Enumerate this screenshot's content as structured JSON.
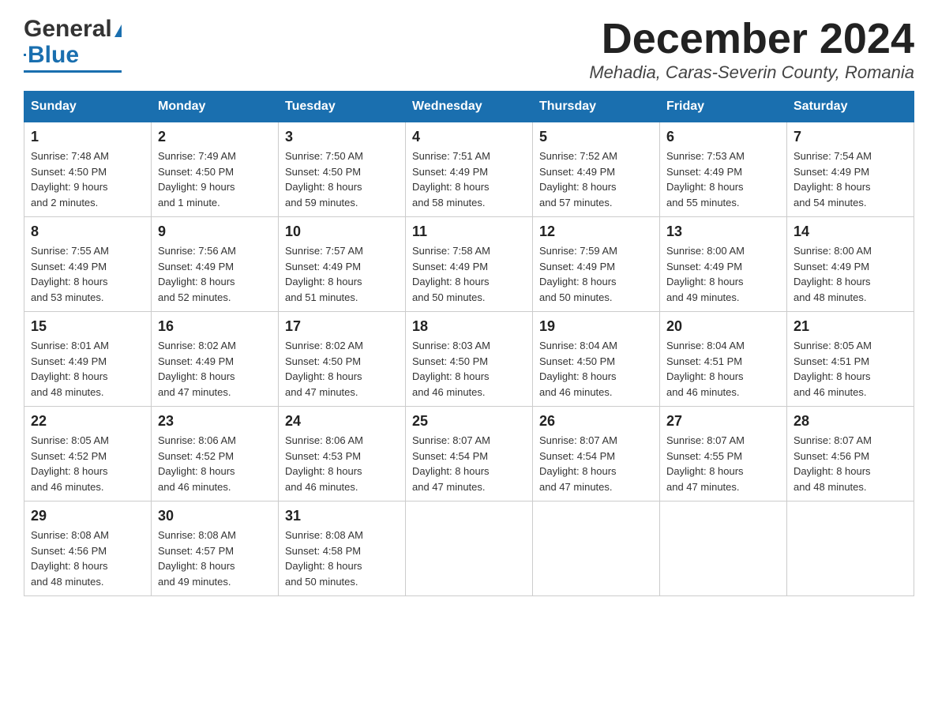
{
  "header": {
    "logo_general": "General",
    "logo_blue": "Blue",
    "month_title": "December 2024",
    "location": "Mehadia, Caras-Severin County, Romania"
  },
  "weekdays": [
    "Sunday",
    "Monday",
    "Tuesday",
    "Wednesday",
    "Thursday",
    "Friday",
    "Saturday"
  ],
  "weeks": [
    [
      {
        "day": "1",
        "sunrise": "7:48 AM",
        "sunset": "4:50 PM",
        "daylight": "9 hours and 2 minutes."
      },
      {
        "day": "2",
        "sunrise": "7:49 AM",
        "sunset": "4:50 PM",
        "daylight": "9 hours and 1 minute."
      },
      {
        "day": "3",
        "sunrise": "7:50 AM",
        "sunset": "4:50 PM",
        "daylight": "8 hours and 59 minutes."
      },
      {
        "day": "4",
        "sunrise": "7:51 AM",
        "sunset": "4:49 PM",
        "daylight": "8 hours and 58 minutes."
      },
      {
        "day": "5",
        "sunrise": "7:52 AM",
        "sunset": "4:49 PM",
        "daylight": "8 hours and 57 minutes."
      },
      {
        "day": "6",
        "sunrise": "7:53 AM",
        "sunset": "4:49 PM",
        "daylight": "8 hours and 55 minutes."
      },
      {
        "day": "7",
        "sunrise": "7:54 AM",
        "sunset": "4:49 PM",
        "daylight": "8 hours and 54 minutes."
      }
    ],
    [
      {
        "day": "8",
        "sunrise": "7:55 AM",
        "sunset": "4:49 PM",
        "daylight": "8 hours and 53 minutes."
      },
      {
        "day": "9",
        "sunrise": "7:56 AM",
        "sunset": "4:49 PM",
        "daylight": "8 hours and 52 minutes."
      },
      {
        "day": "10",
        "sunrise": "7:57 AM",
        "sunset": "4:49 PM",
        "daylight": "8 hours and 51 minutes."
      },
      {
        "day": "11",
        "sunrise": "7:58 AM",
        "sunset": "4:49 PM",
        "daylight": "8 hours and 50 minutes."
      },
      {
        "day": "12",
        "sunrise": "7:59 AM",
        "sunset": "4:49 PM",
        "daylight": "8 hours and 50 minutes."
      },
      {
        "day": "13",
        "sunrise": "8:00 AM",
        "sunset": "4:49 PM",
        "daylight": "8 hours and 49 minutes."
      },
      {
        "day": "14",
        "sunrise": "8:00 AM",
        "sunset": "4:49 PM",
        "daylight": "8 hours and 48 minutes."
      }
    ],
    [
      {
        "day": "15",
        "sunrise": "8:01 AM",
        "sunset": "4:49 PM",
        "daylight": "8 hours and 48 minutes."
      },
      {
        "day": "16",
        "sunrise": "8:02 AM",
        "sunset": "4:49 PM",
        "daylight": "8 hours and 47 minutes."
      },
      {
        "day": "17",
        "sunrise": "8:02 AM",
        "sunset": "4:50 PM",
        "daylight": "8 hours and 47 minutes."
      },
      {
        "day": "18",
        "sunrise": "8:03 AM",
        "sunset": "4:50 PM",
        "daylight": "8 hours and 46 minutes."
      },
      {
        "day": "19",
        "sunrise": "8:04 AM",
        "sunset": "4:50 PM",
        "daylight": "8 hours and 46 minutes."
      },
      {
        "day": "20",
        "sunrise": "8:04 AM",
        "sunset": "4:51 PM",
        "daylight": "8 hours and 46 minutes."
      },
      {
        "day": "21",
        "sunrise": "8:05 AM",
        "sunset": "4:51 PM",
        "daylight": "8 hours and 46 minutes."
      }
    ],
    [
      {
        "day": "22",
        "sunrise": "8:05 AM",
        "sunset": "4:52 PM",
        "daylight": "8 hours and 46 minutes."
      },
      {
        "day": "23",
        "sunrise": "8:06 AM",
        "sunset": "4:52 PM",
        "daylight": "8 hours and 46 minutes."
      },
      {
        "day": "24",
        "sunrise": "8:06 AM",
        "sunset": "4:53 PM",
        "daylight": "8 hours and 46 minutes."
      },
      {
        "day": "25",
        "sunrise": "8:07 AM",
        "sunset": "4:54 PM",
        "daylight": "8 hours and 47 minutes."
      },
      {
        "day": "26",
        "sunrise": "8:07 AM",
        "sunset": "4:54 PM",
        "daylight": "8 hours and 47 minutes."
      },
      {
        "day": "27",
        "sunrise": "8:07 AM",
        "sunset": "4:55 PM",
        "daylight": "8 hours and 47 minutes."
      },
      {
        "day": "28",
        "sunrise": "8:07 AM",
        "sunset": "4:56 PM",
        "daylight": "8 hours and 48 minutes."
      }
    ],
    [
      {
        "day": "29",
        "sunrise": "8:08 AM",
        "sunset": "4:56 PM",
        "daylight": "8 hours and 48 minutes."
      },
      {
        "day": "30",
        "sunrise": "8:08 AM",
        "sunset": "4:57 PM",
        "daylight": "8 hours and 49 minutes."
      },
      {
        "day": "31",
        "sunrise": "8:08 AM",
        "sunset": "4:58 PM",
        "daylight": "8 hours and 50 minutes."
      },
      null,
      null,
      null,
      null
    ]
  ]
}
